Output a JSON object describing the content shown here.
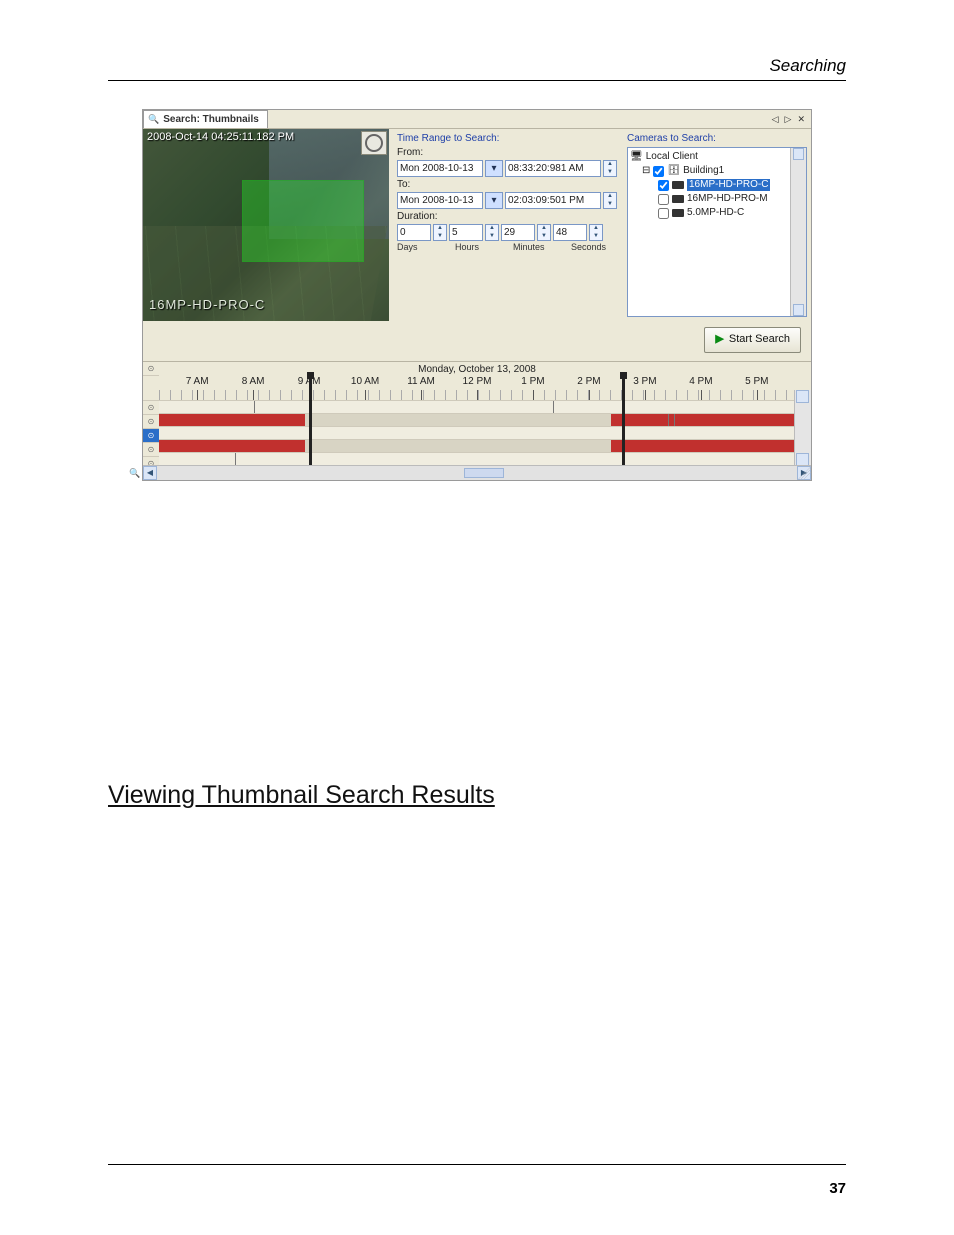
{
  "header": {
    "chapter": "Searching"
  },
  "tab": {
    "title": "Search: Thumbnails"
  },
  "preview": {
    "timestamp": "2008-Oct-14 04:25:11.182 PM",
    "camera": "16MP-HD-PRO-C"
  },
  "timerange": {
    "heading": "Time Range to Search:",
    "from_label": "From:",
    "from_date": "Mon 2008-10-13",
    "from_time": "08:33:20:981 AM",
    "to_label": "To:",
    "to_date": "Mon 2008-10-13",
    "to_time": "02:03:09:501 PM",
    "duration_label": "Duration:",
    "days": "0",
    "hours": "5",
    "minutes": "29",
    "seconds": "48",
    "u_days": "Days",
    "u_hours": "Hours",
    "u_minutes": "Minutes",
    "u_seconds": "Seconds"
  },
  "cameras": {
    "heading": "Cameras to Search:",
    "root": "Local Client",
    "site": "Building1",
    "cam1": "16MP-HD-PRO-C",
    "cam2": "16MP-HD-PRO-M",
    "cam3": "5.0MP-HD-C"
  },
  "buttons": {
    "start": "Start Search"
  },
  "timeline": {
    "date": "Monday, October 13, 2008",
    "hours": [
      "7 AM",
      "8 AM",
      "9 AM",
      "10 AM",
      "11 AM",
      "12 PM",
      "1 PM",
      "2 PM",
      "3 PM",
      "4 PM",
      "5 PM"
    ]
  },
  "section": {
    "heading": "Viewing Thumbnail Search Results"
  },
  "footer": {
    "page": "37"
  }
}
